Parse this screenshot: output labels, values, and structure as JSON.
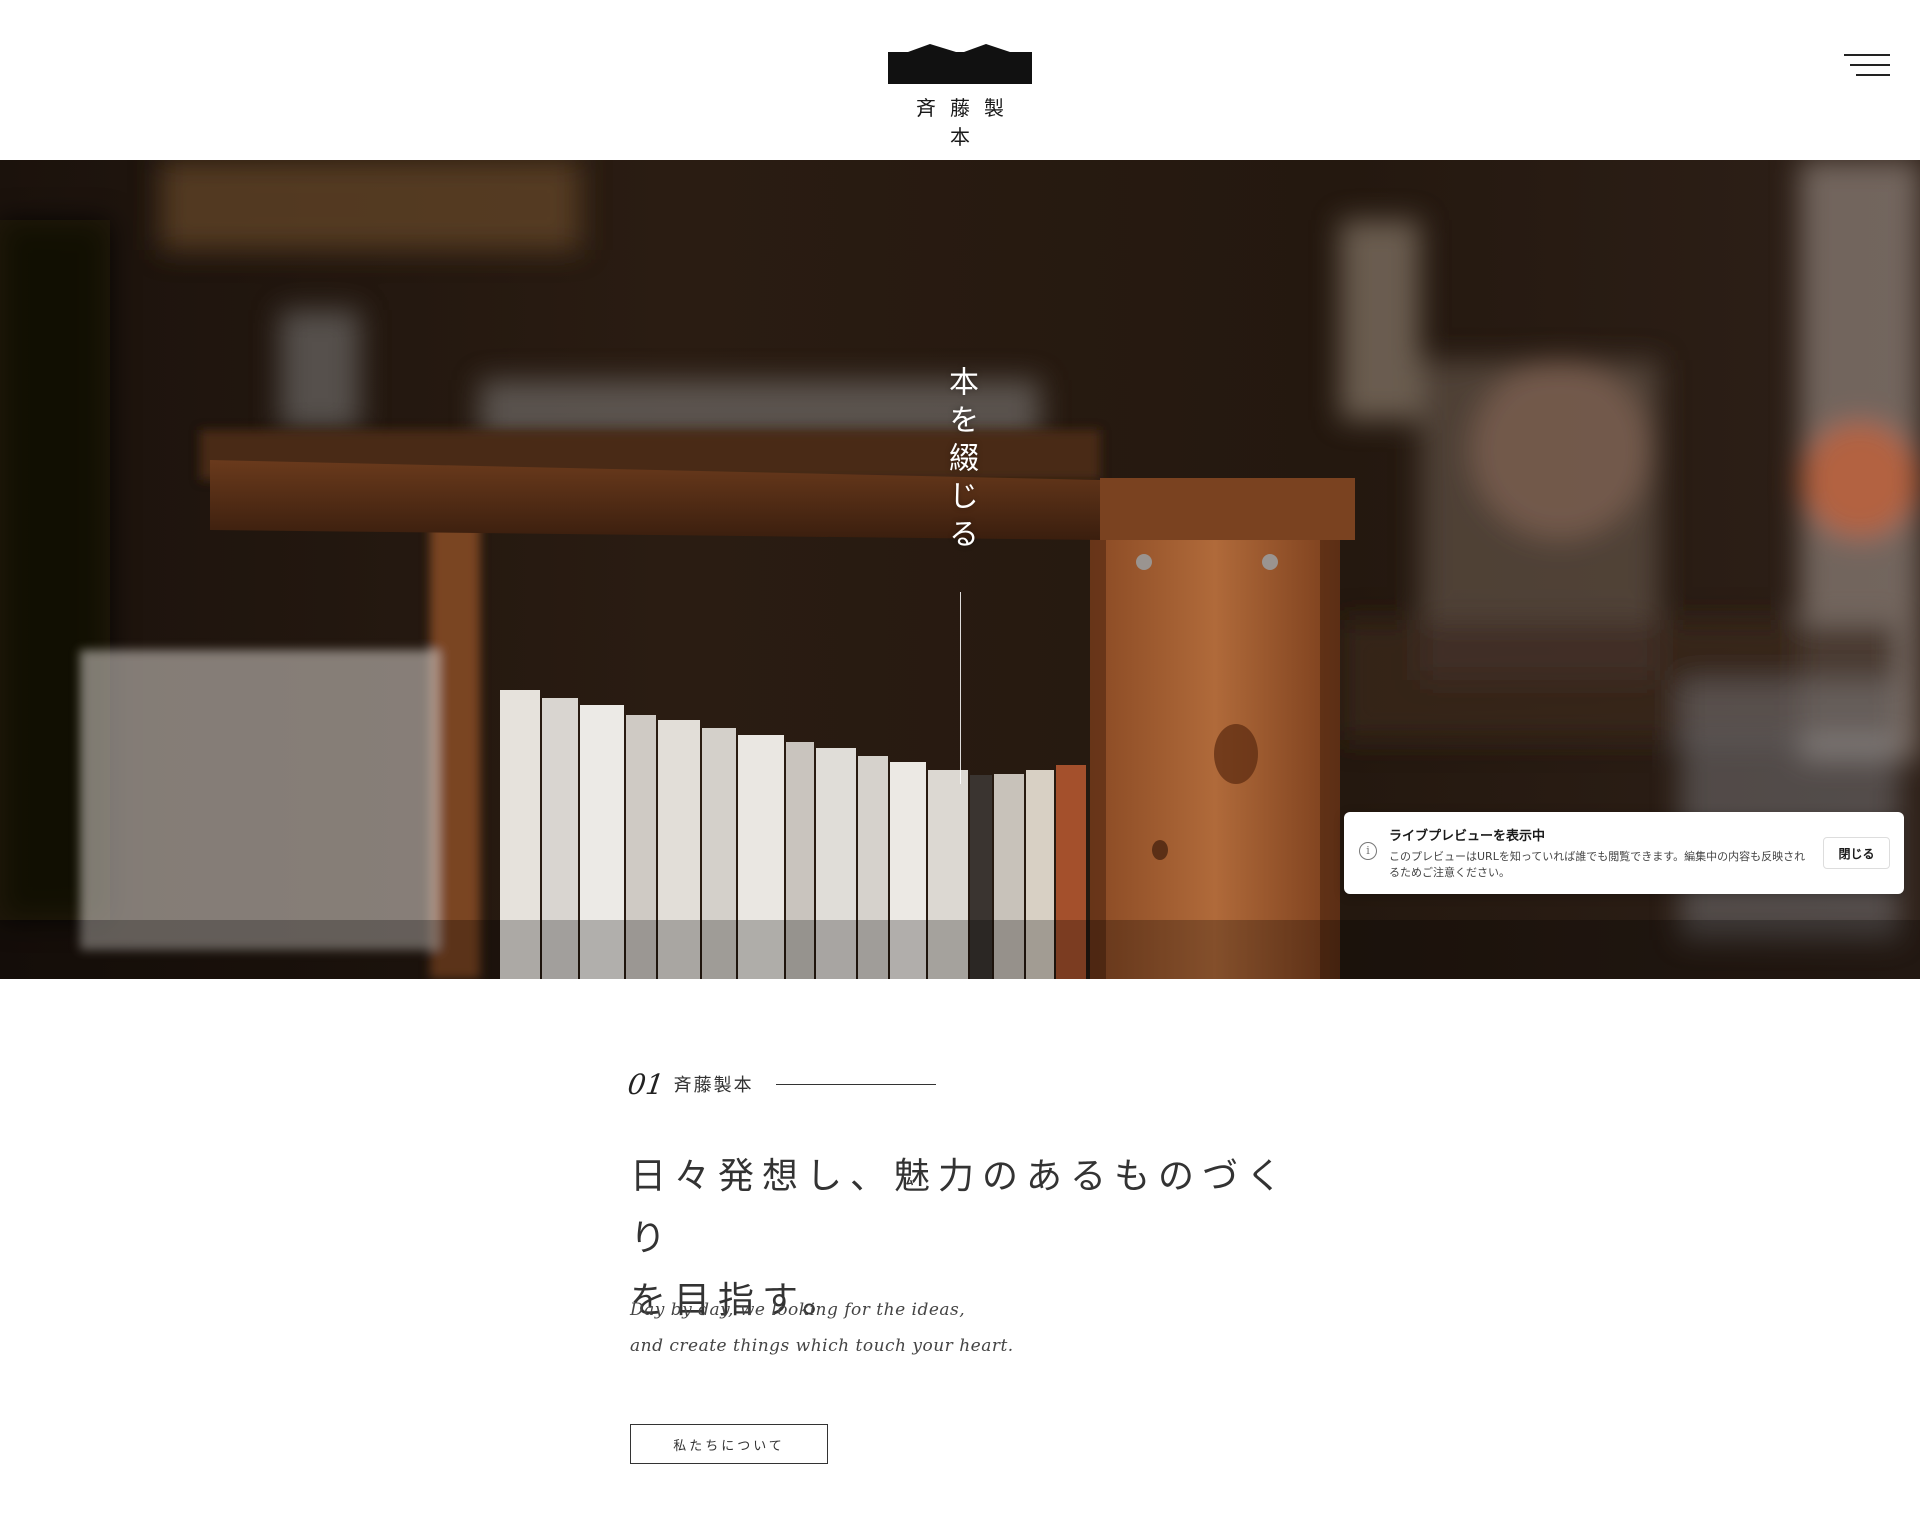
{
  "header": {
    "logo_text": "斉藤製本",
    "menu_icon": "hamburger-icon"
  },
  "hero": {
    "vertical_copy": "本を綴じる"
  },
  "toast": {
    "icon": "info-icon",
    "title": "ライブプレビューを表示中",
    "body": "このプレビューはURLを知っていれば誰でも閲覧できます。編集中の内容も反映されるためご注意ください。",
    "close_label": "閉じる"
  },
  "intro": {
    "number": "01",
    "name": "斉藤製本",
    "headline_line1": "日々発想し、魅力のあるものづくり",
    "headline_line2": "を目指す。",
    "subcopy_line1": "Day by day, we looking for the ideas,",
    "subcopy_line2": "and  create things which touch your heart.",
    "button_label": "私たちについて"
  },
  "colors": {
    "text": "#333333",
    "logo": "#111111",
    "background": "#ffffff"
  }
}
